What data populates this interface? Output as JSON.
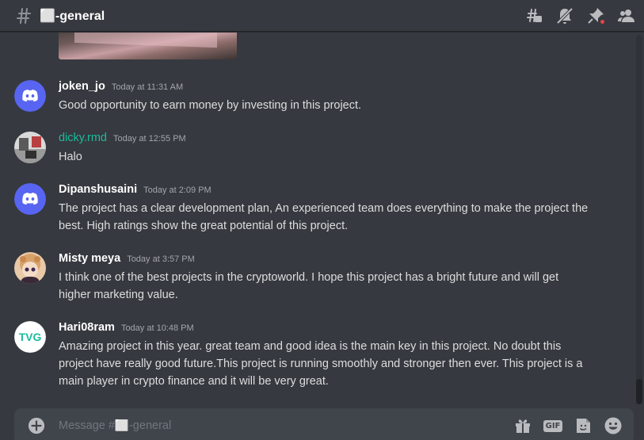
{
  "header": {
    "channel_name": "⬜-general",
    "icons": [
      "threads-icon",
      "mute-icon",
      "pin-icon",
      "members-icon"
    ]
  },
  "messages": [
    {
      "username": "joken_jo",
      "timestamp": "Today at 11:31 AM",
      "text": "Good opportunity to earn money by investing in this project.",
      "avatar": "discord-default"
    },
    {
      "username": "dicky.rmd",
      "timestamp": "Today at 12:55 PM",
      "text": "Halo",
      "avatar": "photo",
      "name_color": "#1abc9c"
    },
    {
      "username": "Dipanshusaini",
      "timestamp": "Today at 2:09 PM",
      "text": "The project has a clear development plan, An experienced team does everything to make the project the best. High ratings show the great potential of this project.",
      "avatar": "discord-default"
    },
    {
      "username": "Misty meya",
      "timestamp": "Today at 3:57 PM",
      "text": "I think one of the best projects in the cryptoworld. I hope this project has a bright future and will get higher marketing value.",
      "avatar": "anime"
    },
    {
      "username": "Hari08ram",
      "timestamp": "Today at 10:48 PM",
      "text": "Amazing project in this year. great team and good idea is the main key in this project. No doubt this project have really good future.This project is running smoothly and stronger then ever. This project is a main player in crypto finance and it will be very great.",
      "avatar": "tvg-logo",
      "avatar_logo_text": "TVG"
    }
  ],
  "composer": {
    "placeholder": "Message #⬜-general",
    "gif_label": "GIF"
  },
  "colors": {
    "background": "#36393f",
    "discord_blurple": "#5865f2",
    "input_bg": "#40444b"
  }
}
